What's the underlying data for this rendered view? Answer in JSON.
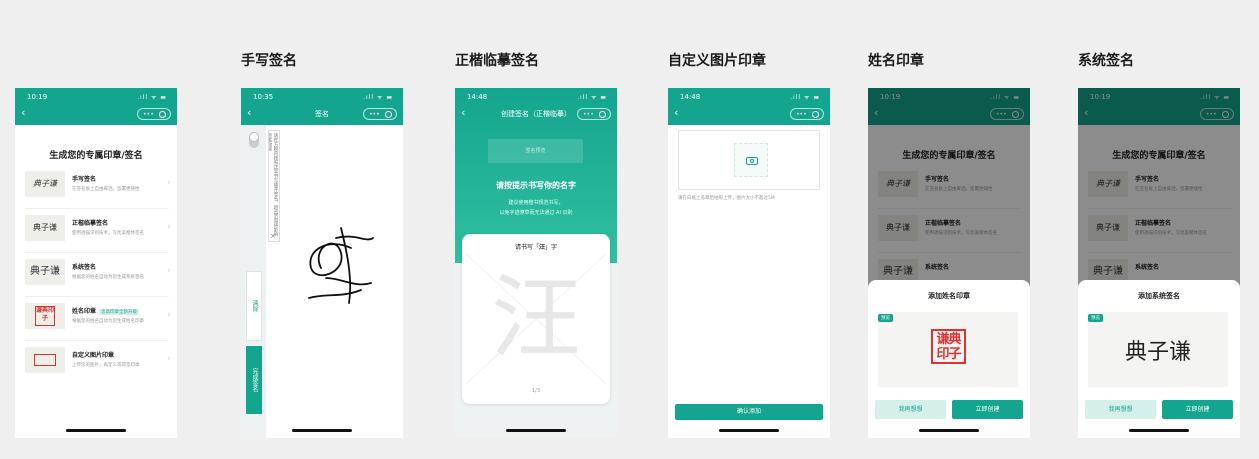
{
  "captions": {
    "handwrite": "手写签名",
    "copy": "正楷临摹签名",
    "custom": "自定义图片印章",
    "name_seal": "姓名印章",
    "system": "系统签名"
  },
  "status": {
    "time1": "10:19",
    "time2": "10:35",
    "time3": "14:48",
    "time4": "14:48",
    "time5": "10:19",
    "time6": "10:19",
    "icons": ".ıll ᯤ ▬"
  },
  "nav": {
    "back": "‹",
    "title2": "签名",
    "title3": "创建签名（正楷临摹）",
    "capsule_dots": "•••"
  },
  "home": {
    "title": "生成您的专属印章/签名",
    "items": [
      {
        "thumb": "典子谦",
        "title": "手写签名",
        "desc": "在签名板上自由挥洒，签署更随性"
      },
      {
        "thumb": "典子谦",
        "title": "正楷临摹签名",
        "desc": "使用透描识别技术，写优美楷体签名"
      },
      {
        "thumb": "典子谦",
        "title": "系统签名",
        "desc": "根据您的姓名自动为您生成系统签名"
      },
      {
        "thumb": "谦典印子",
        "title": "姓名印章",
        "tag": "含高印章全新升级",
        "desc": "根据您的姓名自动为您生成姓名印章"
      },
      {
        "thumb": "",
        "title": "自定义图片印章",
        "desc": "上传您的图片，再定义或得签印章"
      }
    ]
  },
  "handwrite": {
    "hint": "请在方框内按照正常书写顺序签名，超出范围将影响签名效果",
    "clear": "清除",
    "done": "完成签名",
    "close": "×"
  },
  "copy": {
    "banner": "签名预览",
    "prompt": "请按提示书写你的名字",
    "tip1": "建议使用楷书规范书写，",
    "tip2": "以免字迹潦草而无法通过 AI 识别",
    "card_prefix": "请书写「",
    "card_char": "汪",
    "card_suffix": "」字",
    "big_char": "汪",
    "page": "1/3"
  },
  "custom": {
    "upload_hint": "请在白纸上盖章后拍照上传，图片大小不超过5M",
    "confirm": "确认添加"
  },
  "name_seal": {
    "sheet_title": "添加姓名印章",
    "badge": "预览",
    "seal_text": "谦典印子",
    "cancel": "我再想想",
    "create": "立即创建"
  },
  "system": {
    "sheet_title": "添加系统签名",
    "badge": "预览",
    "sig_text": "典子谦",
    "cancel": "我再想想",
    "create": "立即创建"
  }
}
